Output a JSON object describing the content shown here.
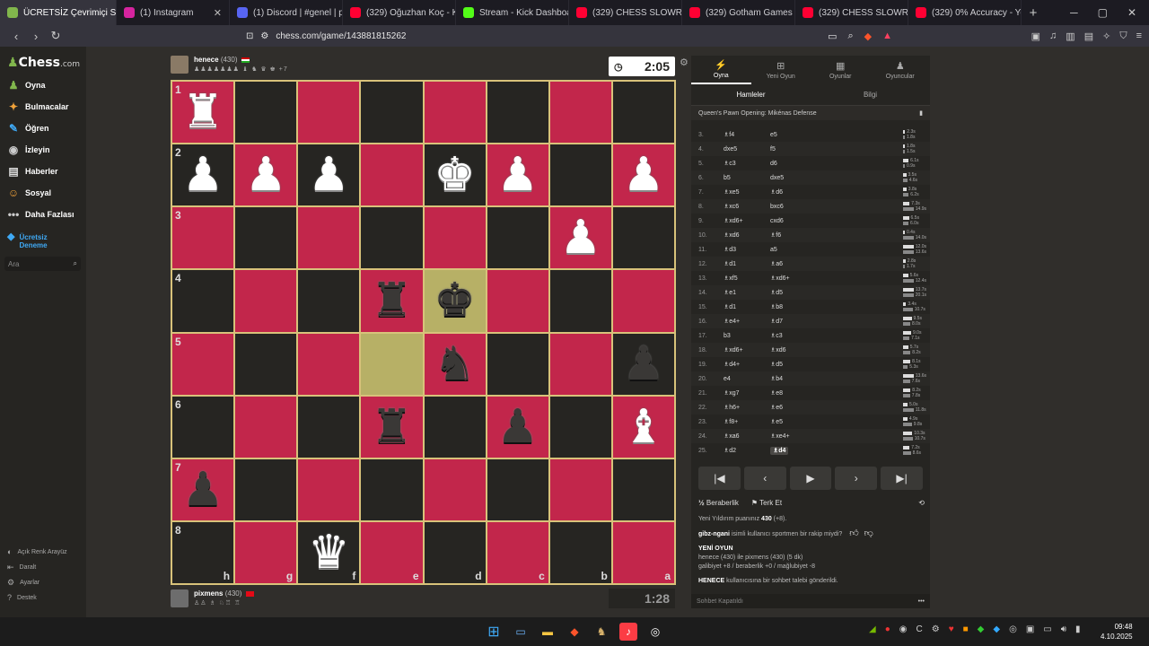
{
  "browser": {
    "tabs": [
      {
        "title": "ÜCRETSİZ Çevrimiçi Sa",
        "color": "#81b64c",
        "active": true
      },
      {
        "title": "(1) Instagram",
        "color": "#d6249f",
        "active": false
      },
      {
        "title": "(1) Discord | #genel | p",
        "color": "#5865f2",
        "active": false
      },
      {
        "title": "(329) Oğuzhan Koç - K",
        "color": "#ff0033",
        "active": false
      },
      {
        "title": "Stream - Kick Dashboard",
        "color": "#53fc18",
        "active": false
      },
      {
        "title": "(329) CHESS SLOWRUN E",
        "color": "#ff0033",
        "active": false
      },
      {
        "title": "(329) Gotham Games - Yo",
        "color": "#ff0033",
        "active": false
      },
      {
        "title": "(329) CHESS SLOWRUN (I",
        "color": "#ff0033",
        "active": false
      },
      {
        "title": "(329) 0% Accuracy - YouTu",
        "color": "#ff0033",
        "active": false
      }
    ],
    "url": "chess.com/game/143881815262"
  },
  "sidebar": {
    "logo_text": "Chess",
    "logo_suffix": ".com",
    "items": [
      {
        "label": "Oyna",
        "icon": "♟"
      },
      {
        "label": "Bulmacalar",
        "icon": "✦"
      },
      {
        "label": "Öğren",
        "icon": "✎"
      },
      {
        "label": "İzleyin",
        "icon": "◉"
      },
      {
        "label": "Haberler",
        "icon": "▤"
      },
      {
        "label": "Sosyal",
        "icon": "☺"
      },
      {
        "label": "Daha Fazlası",
        "icon": "•••"
      }
    ],
    "trial_line1": "Ücretsiz",
    "trial_line2": "Deneme",
    "search_placeholder": "Ara",
    "bottom_items": [
      {
        "label": "Açık Renk Arayüz",
        "icon": "◐"
      },
      {
        "label": "Daralt",
        "icon": "⇤"
      },
      {
        "label": "Ayarlar",
        "icon": "⚙"
      },
      {
        "label": "Destek",
        "icon": "?"
      }
    ]
  },
  "game": {
    "top_player": {
      "name": "henece",
      "rating": "(430)",
      "captured": "♟♟♟♟♟♟♟ ♝ ♞ ♛ ♚",
      "extra": "+7"
    },
    "bottom_player": {
      "name": "pixmens",
      "rating": "(430)",
      "captured": "♙♙ ♗ ♘♖ ♖"
    },
    "top_clock": "2:05",
    "bottom_clock": "1:28",
    "board": [
      [
        "wR",
        "",
        "",
        "",
        "",
        "",
        "",
        ""
      ],
      [
        "wP",
        "wP",
        "wP",
        "",
        "wK",
        "wP",
        "",
        "wP"
      ],
      [
        "",
        "",
        "",
        "",
        "",
        "",
        "wP",
        ""
      ],
      [
        "",
        "",
        "",
        "bR",
        "bK",
        "",
        "",
        ""
      ],
      [
        "",
        "",
        "",
        "",
        "bN",
        "",
        "",
        "bP"
      ],
      [
        "",
        "",
        "",
        "bR",
        "",
        "bP",
        "",
        "wB"
      ],
      [
        "bP",
        "",
        "",
        "",
        "",
        "",
        "",
        ""
      ],
      [
        "",
        "",
        "wQ",
        "",
        "",
        "",
        "",
        ""
      ]
    ],
    "highlight": [
      [
        3,
        4
      ],
      [
        4,
        3
      ]
    ],
    "ranks": [
      "1",
      "2",
      "3",
      "4",
      "5",
      "6",
      "7",
      "8"
    ],
    "files": [
      "h",
      "g",
      "f",
      "e",
      "d",
      "c",
      "b",
      "a"
    ]
  },
  "panel": {
    "tabs": [
      {
        "label": "Oyna",
        "icon": "⚡",
        "active": true
      },
      {
        "label": "Yeni Oyun",
        "icon": "⊞",
        "active": false
      },
      {
        "label": "Oyunlar",
        "icon": "▦",
        "active": false
      },
      {
        "label": "Oyuncular",
        "icon": "♟",
        "active": false
      }
    ],
    "subtabs": [
      {
        "label": "Hamleler",
        "active": true
      },
      {
        "label": "Bilgi",
        "active": false
      }
    ],
    "opening": "Queen's Pawn Opening: Mikénas Defense",
    "moves": [
      {
        "n": "3.",
        "w": "♗f4",
        "b": "e5",
        "tw": "2.3s",
        "tb": "1.8s"
      },
      {
        "n": "4.",
        "w": "dxe5",
        "b": "f5",
        "tw": "1.8s",
        "tb": "1.5s"
      },
      {
        "n": "5.",
        "w": "♗c3",
        "b": "d6",
        "tw": "6.1s",
        "tb": "0.9s"
      },
      {
        "n": "6.",
        "w": "b5",
        "b": "dxe5",
        "tw": "3.5s",
        "tb": "4.6s"
      },
      {
        "n": "7.",
        "w": "♗xe5",
        "b": "♗d6",
        "tw": "3.8s",
        "tb": "6.2s"
      },
      {
        "n": "8.",
        "w": "♗xc6",
        "b": "bxc6",
        "tw": "7.3s",
        "tb": "14.9s"
      },
      {
        "n": "9.",
        "w": "♗xd6+",
        "b": "cxd6",
        "tw": "6.5s",
        "tb": "6.0s"
      },
      {
        "n": "10.",
        "w": "♗xd6",
        "b": "♗f6",
        "tw": "0.4s",
        "tb": "14.0s"
      },
      {
        "n": "11.",
        "w": "♗d3",
        "b": "a5",
        "tw": "12.0s",
        "tb": "13.6s"
      },
      {
        "n": "12.",
        "w": "♗d1",
        "b": "♗a6",
        "tw": "2.8s",
        "tb": "1.7s"
      },
      {
        "n": "13.",
        "w": "♗xf5",
        "b": "♗xd6+",
        "tw": "5.6s",
        "tb": "12.4s"
      },
      {
        "n": "14.",
        "w": "♗e1",
        "b": "♗d5",
        "tw": "13.7s",
        "tb": "20.1s"
      },
      {
        "n": "15.",
        "w": "♗d1",
        "b": "♗b8",
        "tw": "3.4s",
        "tb": "10.7s"
      },
      {
        "n": "16.",
        "w": "♗e4+",
        "b": "♗d7",
        "tw": "9.5s",
        "tb": "8.0s"
      },
      {
        "n": "17.",
        "w": "b3",
        "b": "♗c3",
        "tw": "9.0s",
        "tb": "7.1s"
      },
      {
        "n": "18.",
        "w": "♗xd6+",
        "b": "♗xd6",
        "tw": "5.7s",
        "tb": "8.2s"
      },
      {
        "n": "19.",
        "w": "♗d4+",
        "b": "♗d5",
        "tw": "8.1s",
        "tb": "5.3s"
      },
      {
        "n": "20.",
        "w": "e4",
        "b": "♗b4",
        "tw": "13.6s",
        "tb": "7.6s"
      },
      {
        "n": "21.",
        "w": "♗xg7",
        "b": "♗e8",
        "tw": "8.2s",
        "tb": "7.8s"
      },
      {
        "n": "22.",
        "w": "♗h6+",
        "b": "♗e6",
        "tw": "5.0s",
        "tb": "11.8s"
      },
      {
        "n": "23.",
        "w": "♗f8+",
        "b": "♗e5",
        "tw": "4.9s",
        "tb": "9.8s"
      },
      {
        "n": "24.",
        "w": "♗xa6",
        "b": "♗xe4+",
        "tw": "10.3s",
        "tb": "10.7s"
      },
      {
        "n": "25.",
        "w": "♗d2",
        "b": "♗d4",
        "tw": "7.2s",
        "tb": "8.6s",
        "current": true
      }
    ],
    "actions": {
      "draw": "Beraberlik",
      "resign": "Terk Et",
      "draw_icon": "½",
      "resign_icon": "⚑"
    },
    "chat": {
      "line1_pre": "Yeni Yıldırım puanınız ",
      "line1_bold": "430",
      "line1_post": " (+8).",
      "q_user": "gibz-ngani",
      "q_text": " isimli kullanıcı sportmen bir rakip miydi?",
      "new_game": "YENİ OYUN",
      "ng_line": "henece (430) ile pixmens (430) (5 dk)",
      "ng_stats": "galibiyet +8 / beraberlik +0 / mağlubiyet -8",
      "req_user": "HENECE",
      "req_text": " kullanıcısına bir sohbet talebi gönderildi."
    },
    "chat_placeholder": "Sohbet Kapatıldı"
  },
  "taskbar": {
    "time": "09:48",
    "date": "4.10.2025"
  }
}
